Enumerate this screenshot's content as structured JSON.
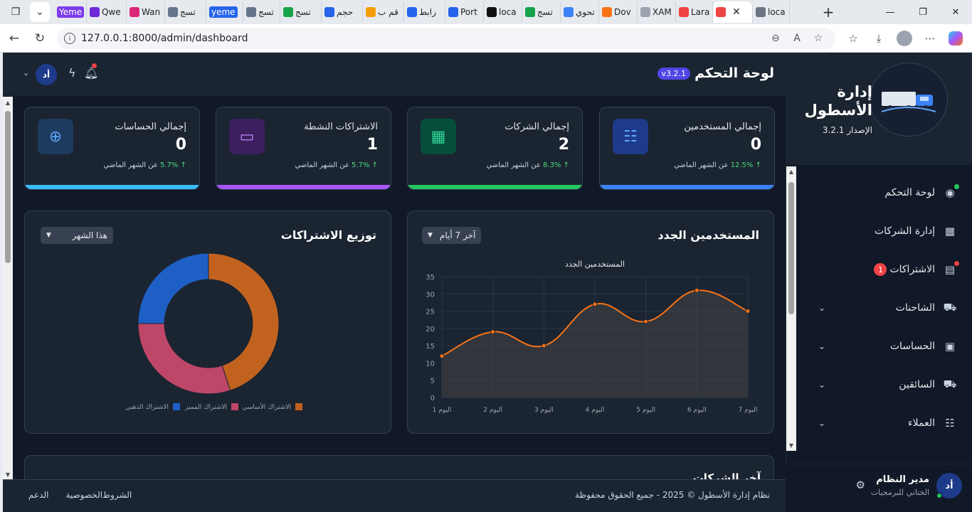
{
  "browser": {
    "tabs": [
      {
        "label": "Yeme",
        "color": "#7c3aed",
        "pill": true
      },
      {
        "label": "Qwe",
        "color": "#6d28d9"
      },
      {
        "label": "Wan",
        "color": "#db2777"
      },
      {
        "label": "تسج",
        "color": "#64748b"
      },
      {
        "label": "yeme",
        "color": "#2563eb",
        "pill": true
      },
      {
        "label": "تسج",
        "color": "#64748b"
      },
      {
        "label": "تسج",
        "color": "#16a34a"
      },
      {
        "label": "حجم",
        "color": "#2563eb"
      },
      {
        "label": "قم ب",
        "color": "#f59e0b"
      },
      {
        "label": "رابط",
        "color": "#2563eb"
      },
      {
        "label": "Port",
        "color": "#2563eb"
      },
      {
        "label": "loca",
        "color": "#111111"
      },
      {
        "label": "تسج",
        "color": "#16a34a"
      },
      {
        "label": "تحوي",
        "color": "#3b82f6"
      },
      {
        "label": "Dov",
        "color": "#f97316"
      },
      {
        "label": "XAM",
        "color": "#9ca3af"
      },
      {
        "label": "Lara",
        "color": "#ef4444"
      },
      {
        "label": "",
        "color": "#ef4444",
        "active": true
      },
      {
        "label": "loca",
        "color": "#6b7280"
      }
    ],
    "url": "127.0.0.1:8000/admin/dashboard"
  },
  "sidebar": {
    "brand_title": "إدارة الأسطول",
    "brand_version": "الإصدار 3.2.1",
    "items": [
      {
        "label": "لوحة التحكم",
        "icon": "gauge-icon",
        "glyph": "◉",
        "dot": "#22c55e"
      },
      {
        "label": "إدارة الشركات",
        "icon": "building-icon",
        "glyph": "▦"
      },
      {
        "label": "الاشتراكات",
        "icon": "file-icon",
        "glyph": "▤",
        "badge": "1",
        "dot": "#ef4444"
      },
      {
        "label": "الشاحنات",
        "icon": "truck-icon",
        "glyph": "⛟",
        "chevron": true
      },
      {
        "label": "الحساسات",
        "icon": "chip-icon",
        "glyph": "▣",
        "chevron": true
      },
      {
        "label": "السائقين",
        "icon": "truck-icon",
        "glyph": "⛟",
        "chevron": true
      },
      {
        "label": "العملاء",
        "icon": "users-icon",
        "glyph": "☷",
        "chevron": true
      }
    ],
    "user": {
      "avatar": "أد",
      "name": "مدير النظام",
      "role": "الختاني للبرمجيات"
    }
  },
  "header": {
    "title": "لوحة التحكم",
    "version": "v3.2.1",
    "avatar": "أد"
  },
  "stats": [
    {
      "title": "إجمالي المستخدمين",
      "value": "0",
      "pct": "↑ 12.5%",
      "suffix": "عن الشهر الماضي",
      "icon": "users-icon",
      "glyph": "☷",
      "icon_bg": "#1e3a8a",
      "icon_color": "#60a5fa",
      "bar": "#3b82f6"
    },
    {
      "title": "إجمالي الشركات",
      "value": "2",
      "pct": "↑ 8.3%",
      "suffix": "عن الشهر الماضي",
      "icon": "building-icon",
      "glyph": "▦",
      "icon_bg": "#064e3b",
      "icon_color": "#34d399",
      "bar": "#22c55e"
    },
    {
      "title": "الاشتراكات النشطة",
      "value": "1",
      "pct": "↑ 5.7%",
      "suffix": "عن الشهر الماضي",
      "icon": "card-icon",
      "glyph": "▭",
      "icon_bg": "#3b1f5e",
      "icon_color": "#c084fc",
      "bar": "#a855f7"
    },
    {
      "title": "إجمالي الحساسات",
      "value": "0",
      "pct": "↑ 5.7%",
      "suffix": "عن الشهر الماضي",
      "icon": "crosshair-icon",
      "glyph": "⊕",
      "icon_bg": "#1e3a5f",
      "icon_color": "#60a5fa",
      "bar": "#38bdf8"
    }
  ],
  "line_panel": {
    "title": "المستخدمين الجدد",
    "select": "آخر 7 أيام"
  },
  "donut_panel": {
    "title": "توزيع الاشتراكات",
    "select": "هذا الشهر"
  },
  "bottom_panel_title": "آخر الشركات",
  "footer": {
    "copyright": "نظام إدارة الأسطول © 2025 - جميع الحقوق محفوظة",
    "links": [
      "الشروط",
      "الخصوصية",
      "الدعم"
    ]
  },
  "chart_data": [
    {
      "type": "area",
      "title": "المستخدمين الجدد",
      "categories": [
        "اليوم 1",
        "اليوم 2",
        "اليوم 3",
        "اليوم 4",
        "اليوم 5",
        "اليوم 6",
        "اليوم 7"
      ],
      "values": [
        12,
        19,
        15,
        27,
        22,
        31,
        25
      ],
      "ylim": [
        0,
        35
      ],
      "yticks": [
        0,
        5,
        10,
        15,
        20,
        25,
        30,
        35
      ],
      "color": "#f97316"
    },
    {
      "type": "pie",
      "labels": [
        "الاشتراك الأساسي",
        "الاشتراك المميز",
        "الاشتراك الذهبي"
      ],
      "values": [
        45,
        30,
        25
      ],
      "colors": [
        "#c2621f",
        "#be4668",
        "#1d5fc4"
      ]
    }
  ]
}
